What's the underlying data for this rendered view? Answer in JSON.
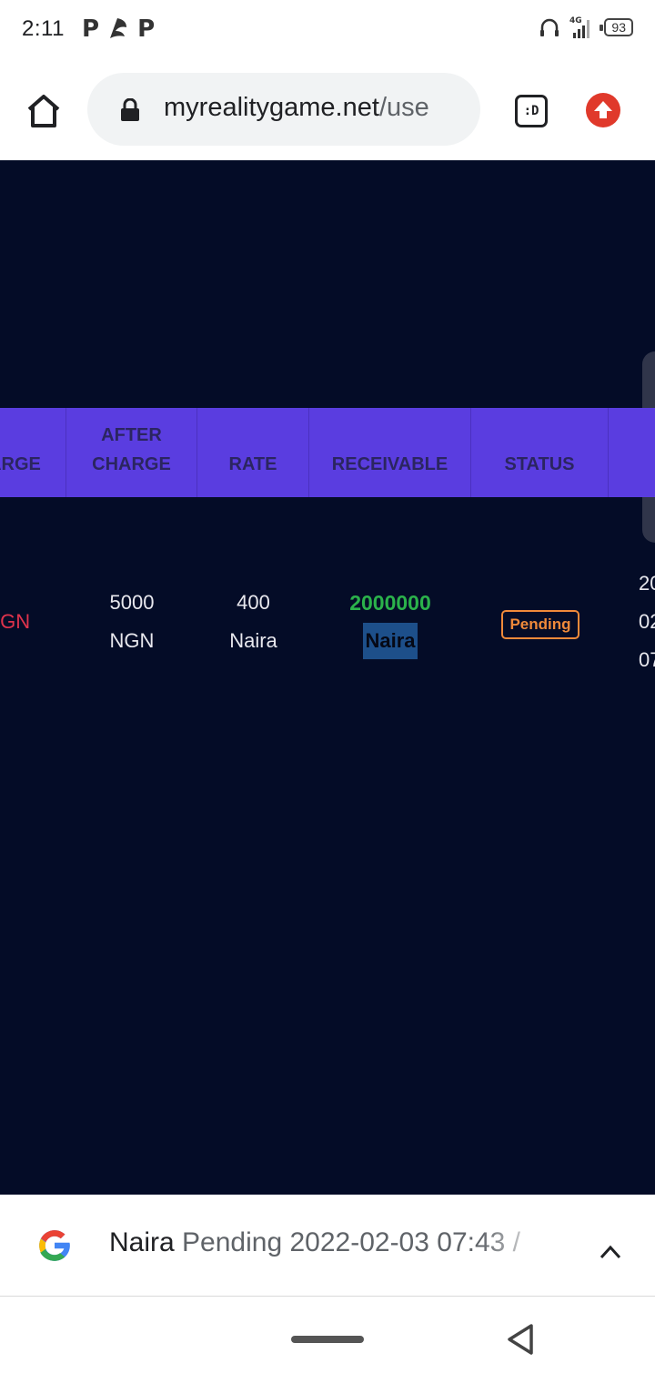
{
  "status_bar": {
    "time": "2:11",
    "notification_icons": [
      "P",
      "P"
    ],
    "network": "4G",
    "battery": "93"
  },
  "browser": {
    "url_domain": "myrealitygame.net",
    "url_path": "/use",
    "tab_switcher_label": ":D"
  },
  "table": {
    "headers": [
      {
        "lines": [
          "ARGE"
        ]
      },
      {
        "lines": [
          "AFTER",
          "CHARGE"
        ]
      },
      {
        "lines": [
          "RATE"
        ]
      },
      {
        "lines": [
          "RECEIVABLE"
        ]
      },
      {
        "lines": [
          "STATUS"
        ]
      }
    ],
    "row": {
      "charge_partial": "IGN",
      "after_charge": [
        "5000",
        "NGN"
      ],
      "rate": [
        "400",
        "Naira"
      ],
      "receivable_amount": "2000000",
      "receivable_unit": "Naira",
      "status": "Pending",
      "date_partial": [
        "20",
        "02",
        "07"
      ]
    }
  },
  "search_banner": {
    "query_strong": "Naira",
    "query_rest": " Pending 2022-02-03 07:43 /"
  },
  "colors": {
    "page_bg": "#040c27",
    "header_bg": "#5a3de0",
    "receivable_green": "#2bb24b",
    "pending_orange": "#f08a3a",
    "charge_red": "#e0334c"
  }
}
